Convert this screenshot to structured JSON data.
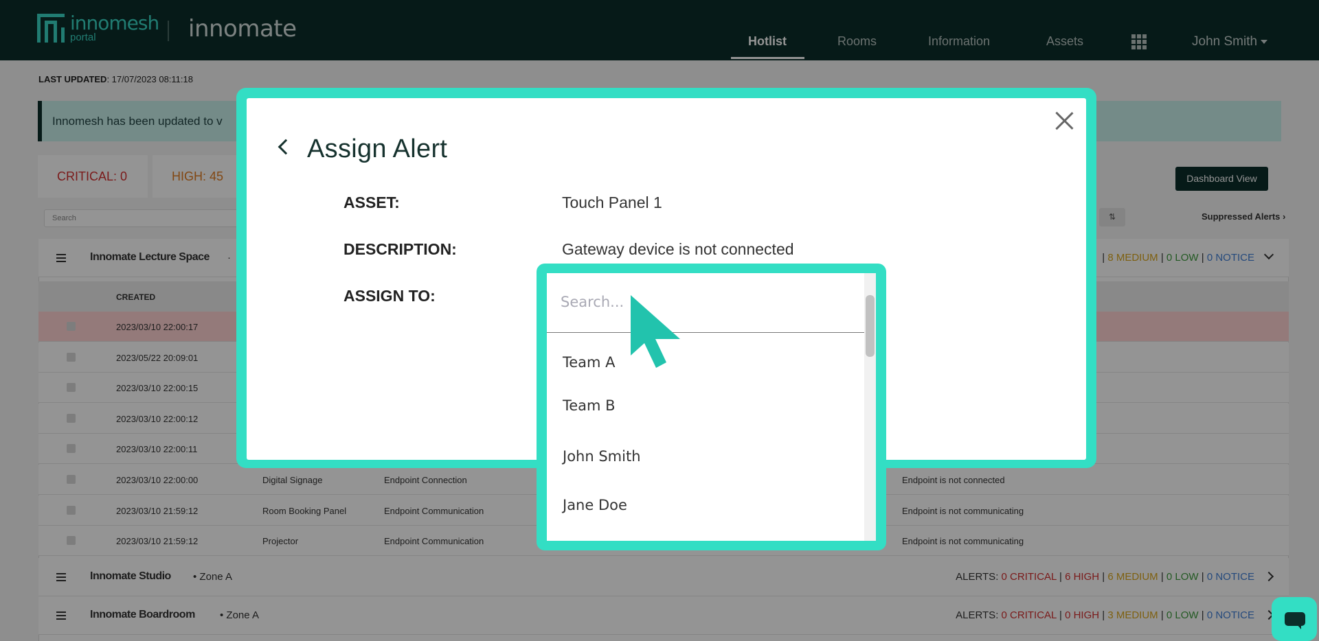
{
  "header": {
    "logo_main": "innomesh",
    "logo_sub": "portal",
    "product": "innomate",
    "nav": [
      "Hotlist",
      "Rooms",
      "Information",
      "Assets"
    ],
    "active_nav": "Hotlist",
    "user": "John Smith"
  },
  "page": {
    "last_updated_label": "LAST UPDATED",
    "last_updated_value": ": 17/07/2023 08:11:18",
    "banner": "Innomesh has been updated to v",
    "critical": "CRITICAL: 0",
    "high": "HIGH: 45",
    "dashboard_button": "Dashboard View",
    "search_placeholder": "Search",
    "suppressed": "Suppressed Alerts",
    "sort_icon": "sort-icon"
  },
  "rooms": [
    {
      "name": "Innomate Lecture Space",
      "zone": "·",
      "alerts_tail": [
        {
          "text": "| ",
          "color": "#333333"
        },
        {
          "text": "8 MEDIUM",
          "color": "#d9a61c"
        },
        {
          "text": " | ",
          "color": "#333333"
        },
        {
          "text": "0 LOW",
          "color": "#3c9a3c"
        },
        {
          "text": " | ",
          "color": "#333333"
        },
        {
          "text": "0 NOTICE",
          "color": "#3f7ed6"
        }
      ]
    },
    {
      "name": "Innomate Studio",
      "zone": "• Zone A",
      "alerts": [
        {
          "text": "ALERTS: ",
          "color": "#333333"
        },
        {
          "text": "0 CRITICAL",
          "color": "#d22d2d"
        },
        {
          "text": " | ",
          "color": "#333333"
        },
        {
          "text": "6 HIGH",
          "color": "#d22d2d"
        },
        {
          "text": " | ",
          "color": "#333333"
        },
        {
          "text": "6 MEDIUM",
          "color": "#d9a61c"
        },
        {
          "text": " | ",
          "color": "#333333"
        },
        {
          "text": "0 LOW",
          "color": "#3c9a3c"
        },
        {
          "text": " | ",
          "color": "#333333"
        },
        {
          "text": "0 NOTICE",
          "color": "#3f7ed6"
        }
      ]
    },
    {
      "name": "Innomate Boardroom",
      "zone": "• Zone A",
      "alerts": [
        {
          "text": "ALERTS: ",
          "color": "#333333"
        },
        {
          "text": "0 CRITICAL",
          "color": "#d22d2d"
        },
        {
          "text": " | ",
          "color": "#333333"
        },
        {
          "text": "0 HIGH",
          "color": "#d22d2d"
        },
        {
          "text": " | ",
          "color": "#333333"
        },
        {
          "text": "3 MEDIUM",
          "color": "#d9a61c"
        },
        {
          "text": " | ",
          "color": "#333333"
        },
        {
          "text": "0 LOW",
          "color": "#3c9a3c"
        },
        {
          "text": " | ",
          "color": "#333333"
        },
        {
          "text": "0 NOTICE",
          "color": "#3f7ed6"
        }
      ]
    }
  ],
  "table": {
    "created_header": "CREATED",
    "rows": [
      {
        "created": "2023/03/10 22:00:17",
        "asset": "",
        "type": "",
        "desc": "",
        "critical": true
      },
      {
        "created": "2023/05/22 20:09:01",
        "asset": "",
        "type": "",
        "desc": ""
      },
      {
        "created": "2023/03/10 22:00:15",
        "asset": "",
        "type": "",
        "desc": ""
      },
      {
        "created": "2023/03/10 22:00:12",
        "asset": "",
        "type": "",
        "desc": ""
      },
      {
        "created": "2023/03/10 22:00:11",
        "asset": "",
        "type": "",
        "desc": ""
      },
      {
        "created": "2023/03/10 22:00:00",
        "asset": "Digital Signage",
        "type": "Endpoint Connection",
        "desc": "Endpoint is not connected"
      },
      {
        "created": "2023/03/10 21:59:12",
        "asset": "Room Booking Panel",
        "type": "Endpoint Communication",
        "desc": "Endpoint is not communicating"
      },
      {
        "created": "2023/03/10 21:59:12",
        "asset": "Projector",
        "type": "Endpoint Communication",
        "desc": "Endpoint is not communicating"
      }
    ]
  },
  "modal": {
    "title": "Assign Alert",
    "asset_label": "ASSET:",
    "asset_value": "Touch Panel 1",
    "description_label": "DESCRIPTION:",
    "description_value": "Gateway device is not connected",
    "assign_label": "ASSIGN TO:"
  },
  "dropdown": {
    "placeholder": "Search...",
    "options": [
      "Team A",
      "Team B",
      "John Smith",
      "Jane Doe"
    ]
  },
  "colors": {
    "header_bg": "#0b2e2a",
    "accent": "#33dec4",
    "critical": "#d22d2d",
    "high": "#e07a1f"
  }
}
